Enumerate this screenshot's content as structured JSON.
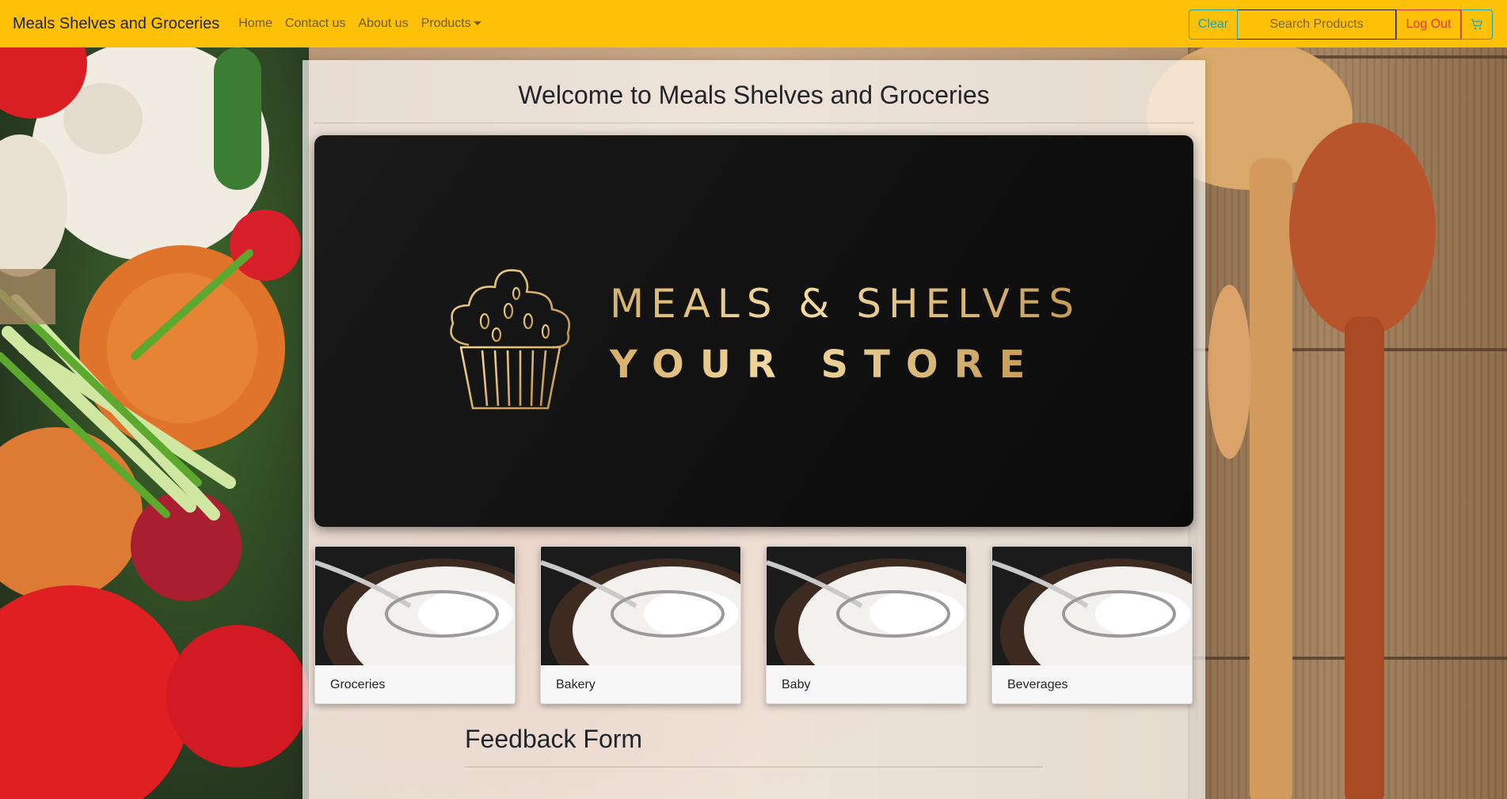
{
  "navbar": {
    "brand": "Meals Shelves and Groceries",
    "links": [
      {
        "label": "Home"
      },
      {
        "label": "Contact us"
      },
      {
        "label": "About us"
      },
      {
        "label": "Products"
      }
    ],
    "clear_label": "Clear",
    "search_placeholder": "Search Products",
    "logout_label": "Log Out",
    "cart_icon": "cart-icon",
    "bg_color": "#ffc107"
  },
  "main": {
    "welcome": "Welcome to Meals Shelves and Groceries",
    "banner": {
      "line1": "MEALS & SHELVES",
      "line2": "YOUR STORE",
      "logo_icon": "cupcake-logo-icon"
    },
    "categories": [
      {
        "label": "Groceries"
      },
      {
        "label": "Bakery"
      },
      {
        "label": "Baby"
      },
      {
        "label": "Beverages"
      }
    ],
    "feedback_title": "Feedback Form"
  }
}
